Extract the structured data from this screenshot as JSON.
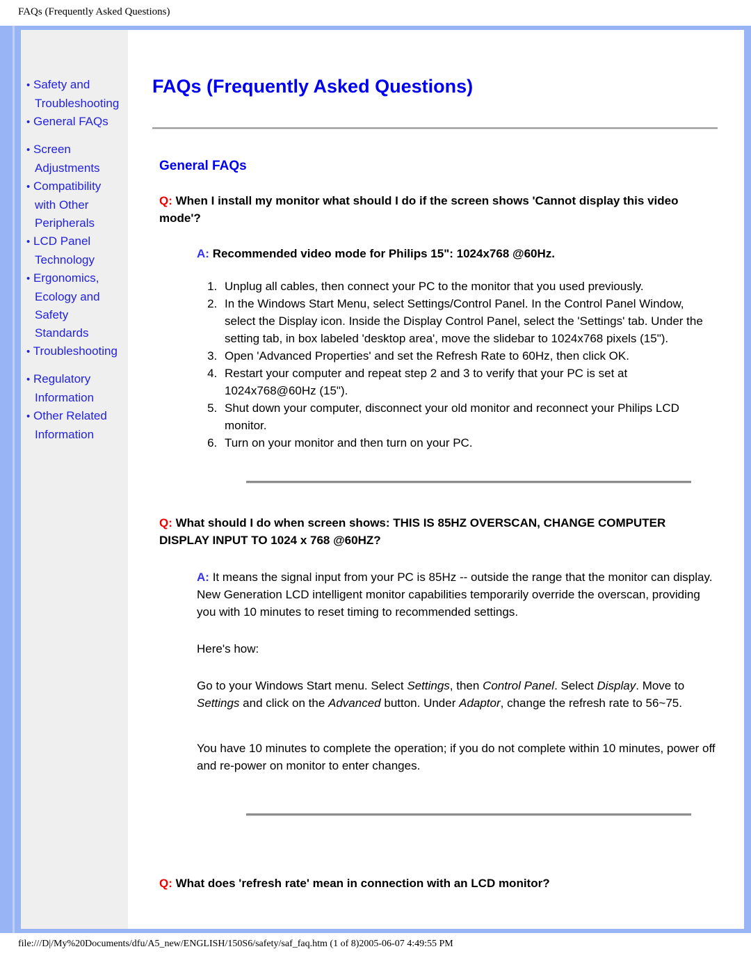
{
  "browser": {
    "header_title": "FAQs (Frequently Asked Questions)",
    "footer_status": "file:///D|/My%20Documents/dfu/A5_new/ENGLISH/150S6/safety/saf_faq.htm (1 of 8)2005-06-07 4:49:55 PM"
  },
  "colors": {
    "frame_blue": "#99b4f5",
    "frame_stripe": "#bed0fa",
    "sidebar_bg": "#efefef",
    "link_blue": "#2222dd",
    "heading_blue": "#0000ee",
    "q_red": "#ee0000",
    "a_blue": "#3333ee",
    "rule_gray": "#8d8d8d"
  },
  "sidebar": {
    "bullet": "•",
    "items": [
      {
        "label": "Safety and Troubleshooting",
        "gap_before": false
      },
      {
        "label": "General FAQs",
        "gap_before": false
      },
      {
        "label": "Screen Adjustments",
        "gap_before": true
      },
      {
        "label": "Compatibility with Other Peripherals",
        "gap_before": false
      },
      {
        "label": "LCD Panel Technology",
        "gap_before": false
      },
      {
        "label": "Ergonomics, Ecology and Safety Standards",
        "gap_before": false
      },
      {
        "label": "Troubleshooting",
        "gap_before": false
      },
      {
        "label": "Regulatory Information",
        "gap_before": true
      },
      {
        "label": "Other Related Information",
        "gap_before": false
      }
    ]
  },
  "main": {
    "page_title": "FAQs (Frequently Asked Questions)",
    "section_title": "General FAQs",
    "q_marker": "Q:",
    "a_marker": "A:",
    "faq1": {
      "question": "When I install my monitor what should I do if the screen shows 'Cannot display this video mode'?",
      "answer": "Recommended video mode for Philips 15\": 1024x768 @60Hz.",
      "steps": [
        "Unplug all cables, then connect your PC to the monitor that you used previously.",
        "In the Windows Start Menu, select Settings/Control Panel. In the Control Panel Window, select the Display icon. Inside the Display Control Panel, select the 'Settings' tab. Under the setting tab, in box labeled 'desktop area', move the slidebar to 1024x768 pixels (15\").",
        "Open 'Advanced Properties' and set the Refresh Rate to 60Hz, then click OK.",
        "Restart your computer and repeat step 2 and 3 to verify that your PC is set at 1024x768@60Hz (15\").",
        "Shut down your computer, disconnect your old monitor and reconnect your Philips LCD monitor.",
        "Turn on your monitor and then turn on your PC."
      ]
    },
    "faq2": {
      "question": "What should I do when screen shows: THIS IS 85HZ OVERSCAN, CHANGE COMPUTER DISPLAY INPUT TO 1024 x 768 @60HZ?",
      "answer": "It means the signal input from your PC is 85Hz -- outside the range that the monitor can display. New Generation LCD intelligent monitor capabilities temporarily override the overscan, providing you with 10 minutes to reset timing to recommended settings.",
      "heres_how": "Here's how:",
      "instructions": {
        "p1_a": "Go to your Windows Start menu. Select ",
        "p1_i1": "Settings",
        "p1_b": ", then ",
        "p1_i2": "Control Panel",
        "p1_c": ". Select ",
        "p1_i3": "Display",
        "p1_d": ". Move to ",
        "p1_i4": "Settings",
        "p1_e": " and click on the ",
        "p1_i5": "Advanced",
        "p1_f": " button. Under ",
        "p1_i6": "Adaptor",
        "p1_g": ", change the refresh rate to 56~75."
      },
      "note": "You have 10 minutes to complete the operation; if you do not complete within 10 minutes, power off and re-power on monitor to enter changes."
    },
    "faq3": {
      "question": "What does 'refresh rate' mean in connection with an LCD monitor?"
    }
  }
}
